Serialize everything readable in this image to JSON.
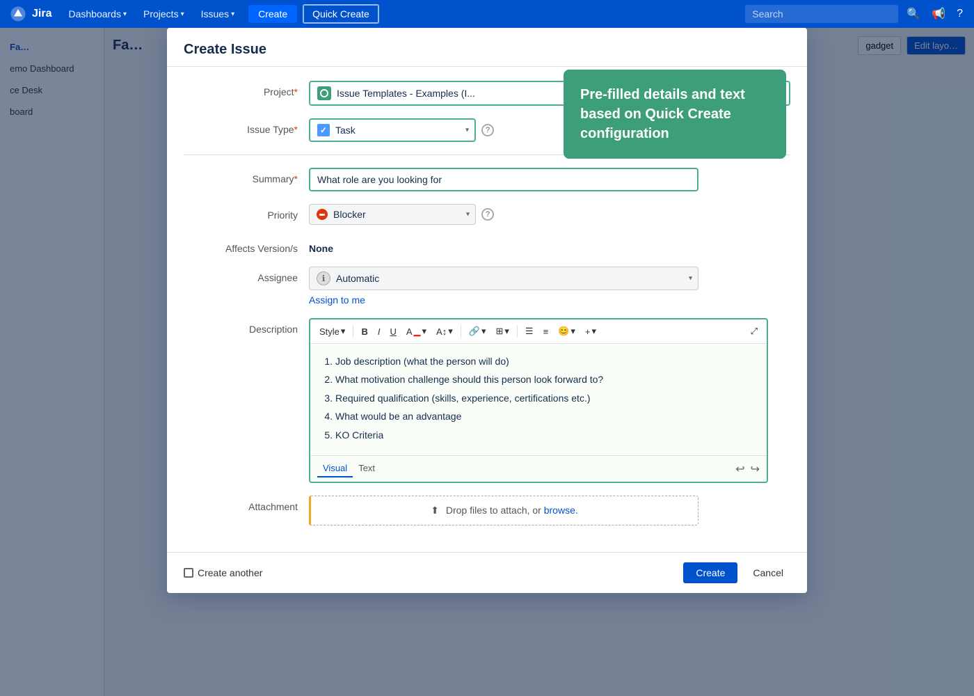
{
  "topnav": {
    "logo_text": "Jira",
    "nav_items": [
      {
        "label": "Dashboards",
        "id": "dashboards"
      },
      {
        "label": "Projects",
        "id": "projects"
      },
      {
        "label": "Issues",
        "id": "issues"
      }
    ],
    "create_label": "Create",
    "quick_create_label": "Quick Create",
    "search_placeholder": "Search"
  },
  "sidebar": {
    "items": [
      {
        "label": "Fa…",
        "id": "fa"
      },
      {
        "label": "emo Dashboard",
        "id": "demo"
      },
      {
        "label": "ce Desk",
        "id": "ce-desk"
      },
      {
        "label": "board",
        "id": "board"
      }
    ]
  },
  "bg_header": {
    "title": "Fa…",
    "gadget_btn": "gadget",
    "edit_layout_btn": "Edit layo…"
  },
  "modal": {
    "title": "Create Issue",
    "tooltip": {
      "text": "Pre-filled details and text based on Quick Create configuration"
    },
    "project_label": "Project",
    "project_required": true,
    "project_value": "Issue Templates - Examples (I...",
    "issue_type_label": "Issue Type",
    "issue_type_required": true,
    "issue_type_value": "Task",
    "summary_label": "Summary",
    "summary_required": true,
    "summary_value": "What role are you looking for",
    "priority_label": "Priority",
    "priority_value": "Blocker",
    "affects_version_label": "Affects Version/s",
    "affects_version_value": "None",
    "assignee_label": "Assignee",
    "assignee_value": "Automatic",
    "assign_to_me_label": "Assign to me",
    "description_label": "Description",
    "description_items": [
      "Job description (what the person will do)",
      "What motivation challenge should this person look forward to?",
      "Required qualification (skills, experience, certifications etc.)",
      "What would be an advantage",
      "KO Criteria"
    ],
    "editor_tab_visual": "Visual",
    "editor_tab_text": "Text",
    "attachment_label": "Attachment",
    "attachment_text": "Drop files to attach, or ",
    "attachment_browse": "browse.",
    "create_another_label": "Create another",
    "create_btn": "Create",
    "cancel_btn": "Cancel",
    "toolbar": {
      "style_label": "Style",
      "bold": "B",
      "italic": "I",
      "underline": "U"
    }
  }
}
